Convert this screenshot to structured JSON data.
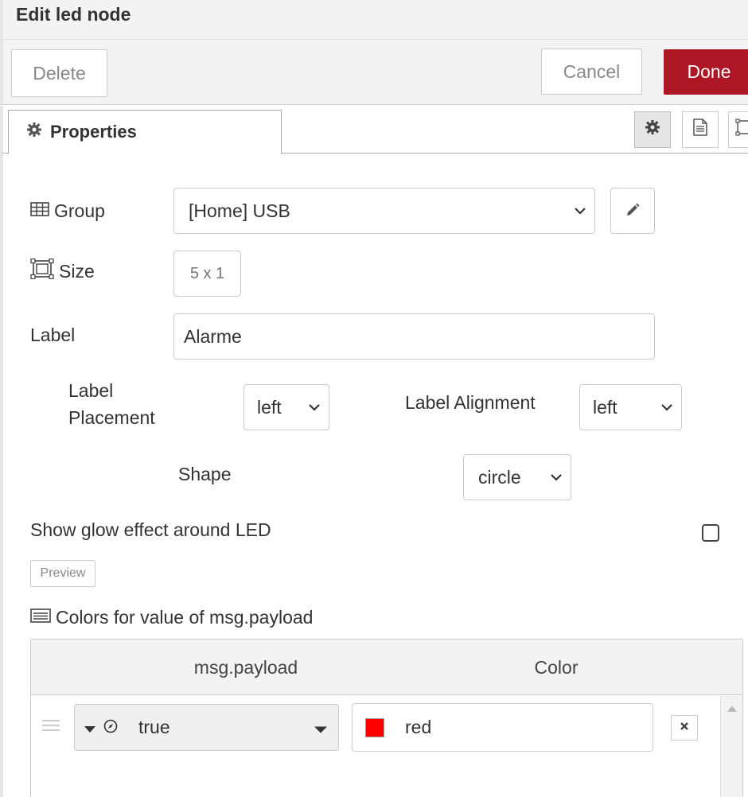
{
  "dialog": {
    "title": "Edit led node"
  },
  "toolbar": {
    "delete_label": "Delete",
    "cancel_label": "Cancel",
    "done_label": "Done",
    "done_color": "#ad1625"
  },
  "tabs": {
    "properties_label": "Properties"
  },
  "form": {
    "group": {
      "label": "Group",
      "value": "[Home] USB"
    },
    "size": {
      "label": "Size",
      "value": "5 x 1"
    },
    "label": {
      "label": "Label",
      "value": "Alarme"
    },
    "label_placement": {
      "label_line1": "Label",
      "label_line2": "Placement",
      "value": "left"
    },
    "label_alignment": {
      "label": "Label Alignment",
      "value": "left"
    },
    "shape": {
      "label": "Shape",
      "value": "circle"
    },
    "glow": {
      "label": "Show glow effect around LED",
      "checked": false
    },
    "preview_label": "Preview",
    "colors_heading": "Colors for value of msg.payload"
  },
  "colors_table": {
    "columns": [
      "msg.payload",
      "Color"
    ],
    "rows": [
      {
        "value": "true",
        "color_name": "red",
        "color_hex": "#ff0000"
      }
    ]
  },
  "icons": {
    "properties": "gear-icon",
    "description": "document-icon",
    "appearance": "layout-icon",
    "group": "table-icon",
    "size": "resize-icon",
    "edit_group": "pencil-icon",
    "colors": "list-icon",
    "remove_row": "close-icon"
  }
}
